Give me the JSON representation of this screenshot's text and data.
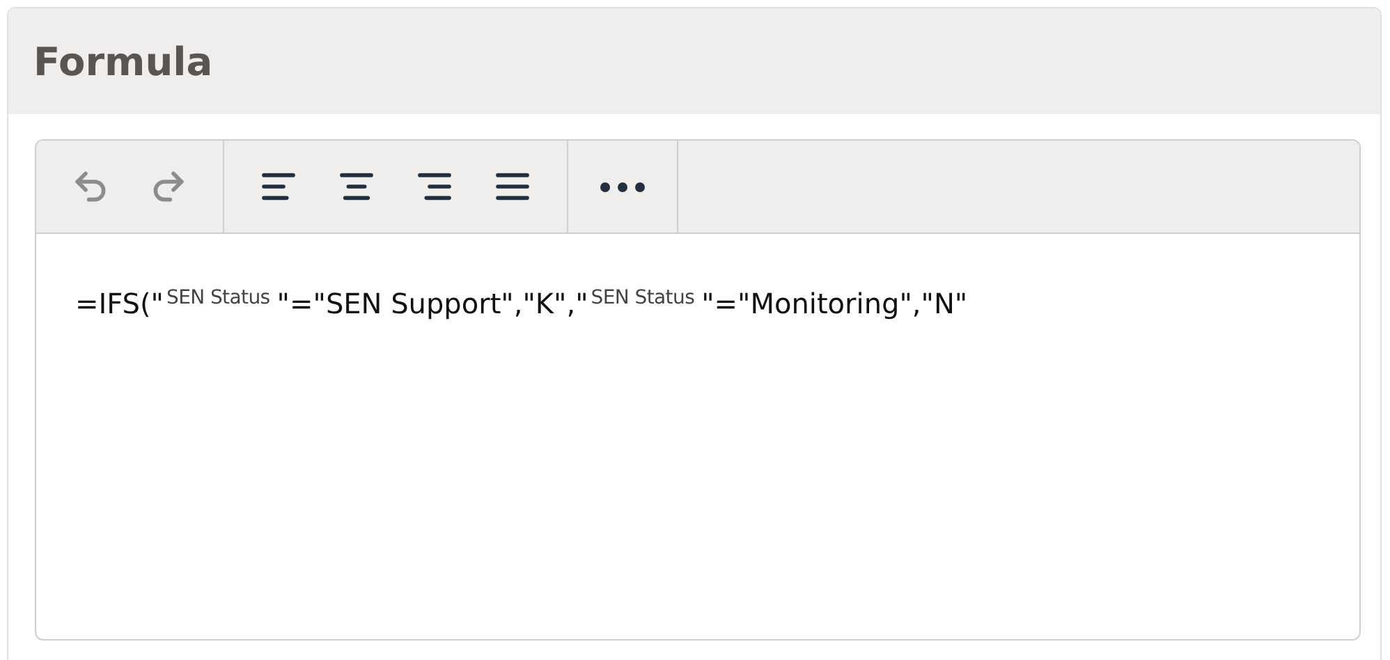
{
  "panel": {
    "title": "Formula"
  },
  "toolbar": {
    "groups": [
      [
        {
          "kind": "undo",
          "disabled": true
        },
        {
          "kind": "redo",
          "disabled": true
        }
      ],
      [
        {
          "kind": "align-left",
          "disabled": false
        },
        {
          "kind": "align-center",
          "disabled": false
        },
        {
          "kind": "align-right",
          "disabled": false
        },
        {
          "kind": "align-justify",
          "disabled": false
        }
      ],
      [
        {
          "kind": "more",
          "disabled": false
        }
      ]
    ]
  },
  "formula": [
    {
      "kind": "text",
      "text": "=IFS(\""
    },
    {
      "kind": "field",
      "text": "SEN Status"
    },
    {
      "kind": "text",
      "text": "\"=\"SEN Support\",\"K\",\""
    },
    {
      "kind": "field",
      "text": "SEN Status"
    },
    {
      "kind": "text",
      "text": "\"=\"Monitoring\",\"N\""
    }
  ]
}
